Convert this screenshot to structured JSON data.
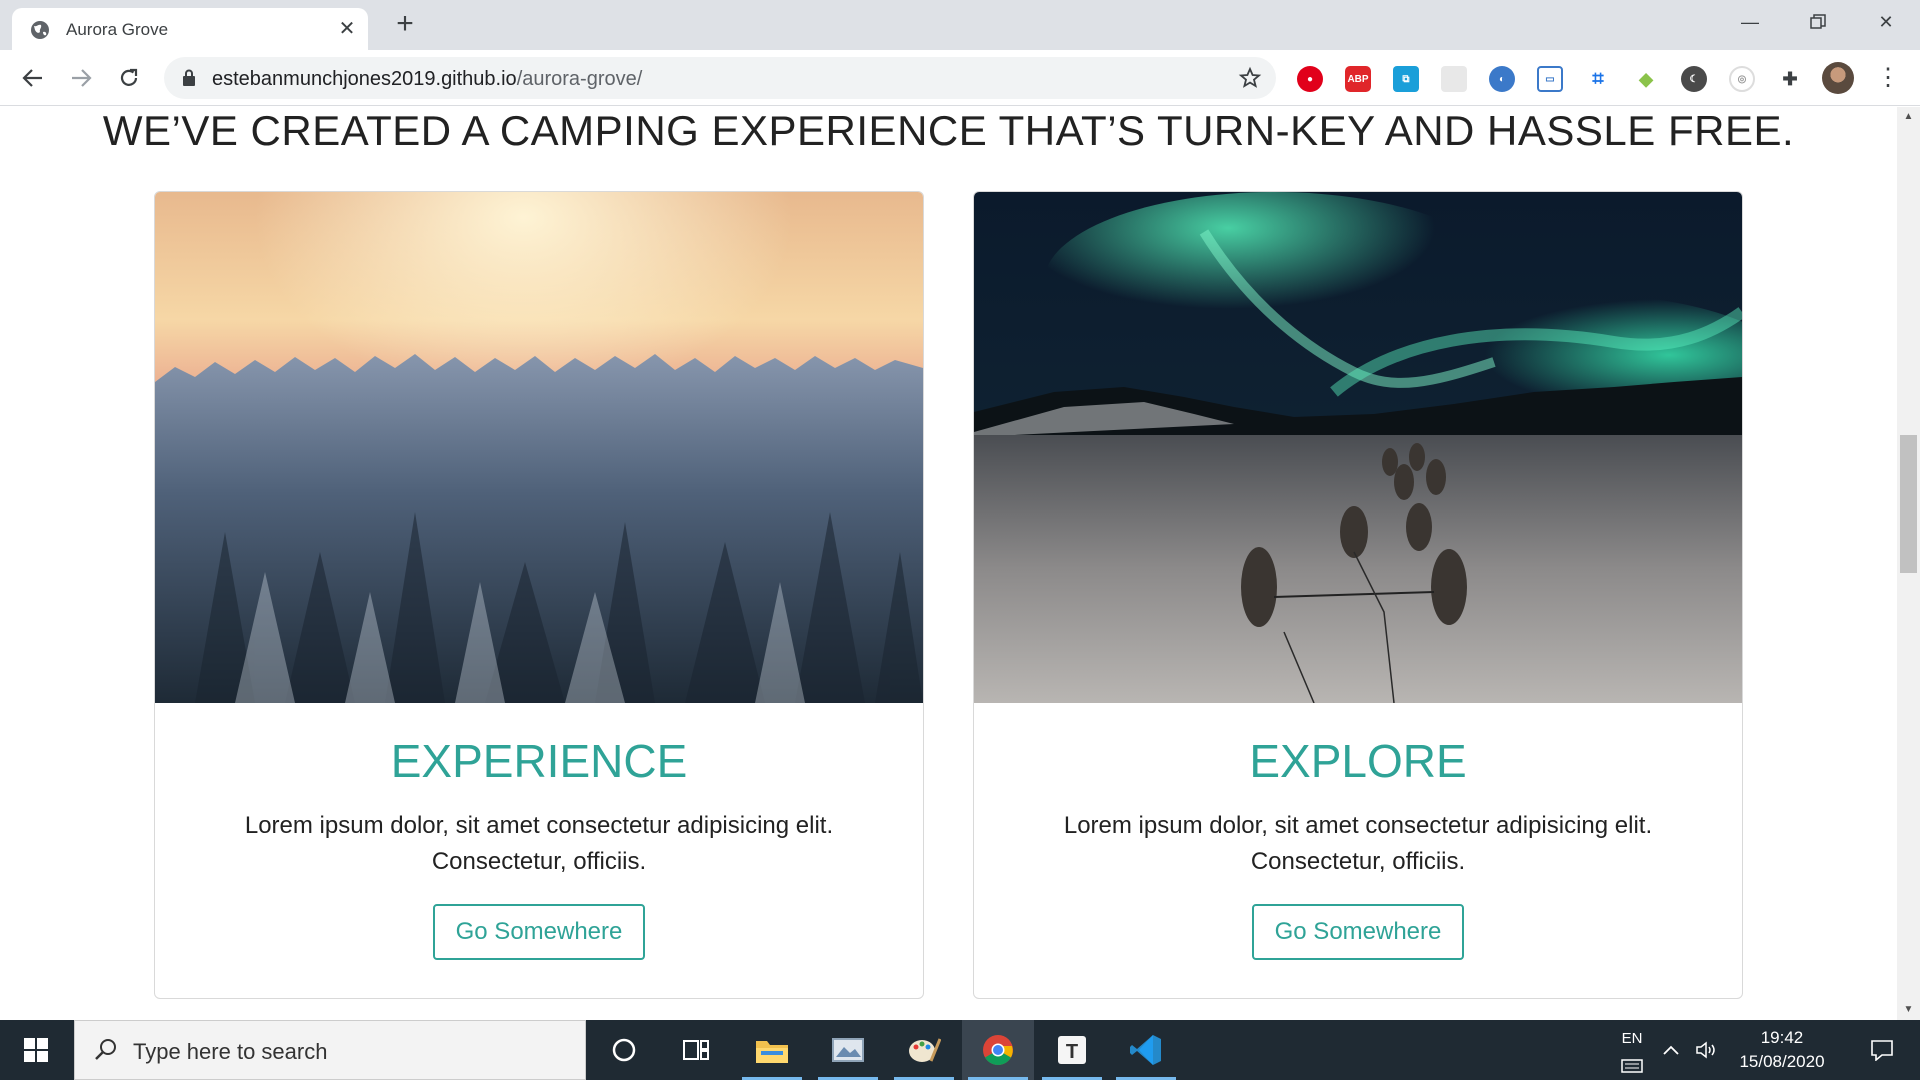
{
  "browser": {
    "tab_title": "Aurora Grove",
    "url_host": "estebanmunchjones2019.github.io",
    "url_path": "/aurora-grove/"
  },
  "page": {
    "headline": "WE’VE CREATED A CAMPING EXPERIENCE THAT’S TURN-KEY AND HASSLE FREE.",
    "cards": [
      {
        "title": "EXPERIENCE",
        "text": "Lorem ipsum dolor, sit amet consectetur adipisicing elit. Consectetur, officiis.",
        "button": "Go Somewhere"
      },
      {
        "title": "EXPLORE",
        "text": "Lorem ipsum dolor, sit amet consectetur adipisicing elit. Consectetur, officiis.",
        "button": "Go Somewhere"
      }
    ]
  },
  "taskbar": {
    "search_placeholder": "Type here to search",
    "language": "EN",
    "time": "19:42",
    "date": "15/08/2020"
  },
  "colors": {
    "accent": "#2fa397",
    "taskbar": "#1f2a33"
  }
}
